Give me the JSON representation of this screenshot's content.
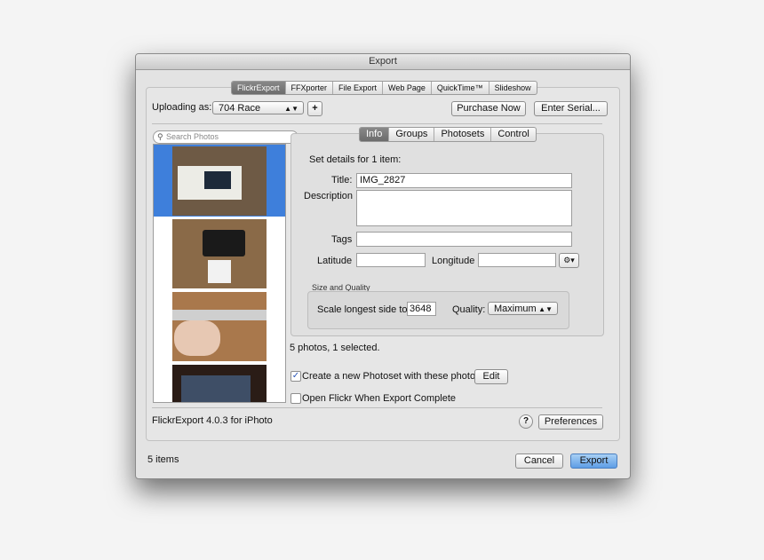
{
  "window": {
    "title": "Export"
  },
  "export_tabs": [
    "FlickrExport",
    "FFXporter",
    "File Export",
    "Web Page",
    "QuickTime™",
    "Slideshow"
  ],
  "header": {
    "uploading_label": "Uploading as:",
    "account_value": "704 Race",
    "add_label": "+",
    "purchase_label": "Purchase Now",
    "serial_label": "Enter Serial..."
  },
  "sidebar": {
    "search_placeholder": "Search Photos",
    "photos_count": 4
  },
  "info_tabs": [
    "Info",
    "Groups",
    "Photosets",
    "Control"
  ],
  "info": {
    "heading": "Set details for 1 item:",
    "title_label": "Title:",
    "title_value": "IMG_2827",
    "description_label": "Description",
    "tags_label": "Tags",
    "latitude_label": "Latitude",
    "longitude_label": "Longitude"
  },
  "size_quality": {
    "section_label": "Size and Quality",
    "scale_label": "Scale longest side to:",
    "scale_value": "3648",
    "quality_label": "Quality:",
    "quality_value": "Maximum"
  },
  "status": "5 photos, 1 selected.",
  "options": {
    "photoset_label": "Create a new Photoset with these photos",
    "photoset_checked": true,
    "edit_label": "Edit",
    "open_flickr_label": "Open Flickr When Export Complete",
    "open_flickr_checked": false
  },
  "footer": {
    "version": "FlickrExport 4.0.3 for iPhoto",
    "help_label": "?",
    "preferences_label": "Preferences",
    "items_count": "5 items",
    "cancel_label": "Cancel",
    "export_label": "Export"
  },
  "colors": {
    "selection": "#3e7fdb",
    "primary_button": "#5e9de6"
  }
}
